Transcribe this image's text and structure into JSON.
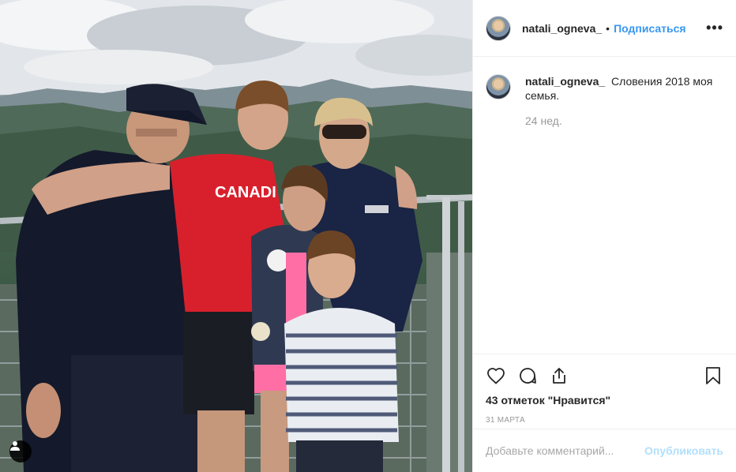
{
  "post": {
    "username": "natali_ogneva_",
    "separator": "•",
    "follow_label": "Подписаться",
    "more_label": "•••",
    "caption_username": "natali_ogneva_",
    "caption_text": "Словения 2018 моя семья.",
    "caption_time": "24 нед.",
    "likes": "43 отметок \"Нравится\"",
    "date": "31 марта",
    "comment_placeholder": "Добавьте комментарий...",
    "publish_label": "Опубликовать",
    "photo_shirt_text": "CANADI"
  },
  "colors": {
    "accent": "#3897f0",
    "publish_disabled": "#b2dffc",
    "muted": "#999999",
    "divider": "#efefef"
  },
  "icons": {
    "like": "heart-icon",
    "comment": "comment-icon",
    "share": "share-icon",
    "save": "bookmark-icon",
    "tags": "user-tag-icon"
  }
}
